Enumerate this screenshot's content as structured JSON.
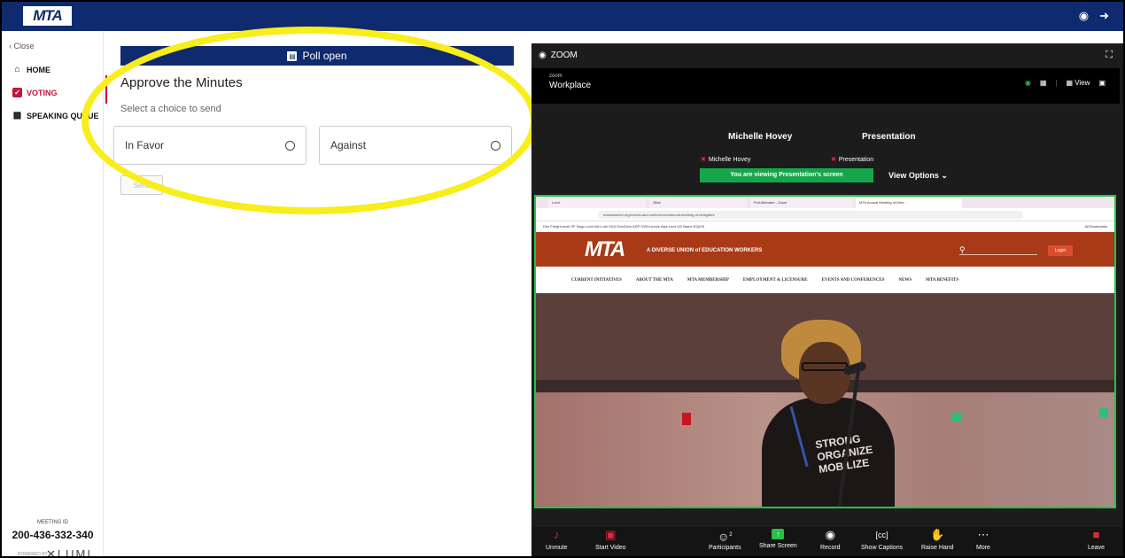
{
  "app": {
    "logo": "MTA",
    "header_icons": [
      "user-circle-icon",
      "logout-icon"
    ]
  },
  "sidebar": {
    "close_label": "Close",
    "items": [
      {
        "label": "HOME",
        "icon": "home-icon"
      },
      {
        "label": "VOTING",
        "icon": "voting-icon",
        "active": true
      },
      {
        "label": "SPEAKING QUEUE",
        "icon": "chat-icon"
      }
    ],
    "meeting_id_label": "MEETING ID",
    "meeting_id": "200-436-332-340",
    "powered_by": "POWERED BY",
    "brand": "LUMI"
  },
  "poll": {
    "status": "Poll open",
    "title": "Approve the Minutes",
    "instruction": "Select a choice to send",
    "choices": [
      "In Favor",
      "Against"
    ],
    "send_label": "Send"
  },
  "zoom": {
    "panel_title": "ZOOM",
    "app_small": "zoom",
    "app_name": "Workplace",
    "view_label": "View",
    "participant_1": "Michelle Hovey",
    "participant_2": "Presentation",
    "tag_1": "Michelle Hovey",
    "tag_2": "Presentation",
    "viewing": "You are viewing  Presentation's screen",
    "view_options": "View Options",
    "toolbar": {
      "unmute": "Unmute",
      "start_video": "Start Video",
      "participants": "Participants",
      "participants_count": "2",
      "share_screen": "Share Screen",
      "record": "Record",
      "captions": "Show Captions",
      "raise_hand": "Raise Hand",
      "more": "More",
      "leave": "Leave"
    }
  },
  "shared_screen": {
    "tabs": [
      "Lumi",
      "Slido",
      "Poll Attendee - Zoom",
      "MTA Annual Meeting of Dele..."
    ],
    "url": "massteacher.org/events-and-conferences/annual-meeting-of-delegates",
    "bookmarks": "Dev   Freight   work   SF   Sago   Lumi NA   Lumi USA   OneDrive   ADP   SVB   Invoice   Asia Lumi US   Bame   EQUIS",
    "bookmarks_right": "All Bookmarks",
    "site_logo": "MTA",
    "tagline": "A DIVERSE UNION of EDUCATION WORKERS",
    "login": "Login",
    "nav": [
      "CURRENT INITIATIVES",
      "ABOUT THE MTA",
      "MTA MEMBERSHIP",
      "EMPLOYMENT & LICENSURE",
      "EVENTS AND CONFERENCES",
      "NEWS",
      "MTA BENEFITS"
    ],
    "shirt_text": "STRONG ORGANIZE MOBILIZE"
  }
}
